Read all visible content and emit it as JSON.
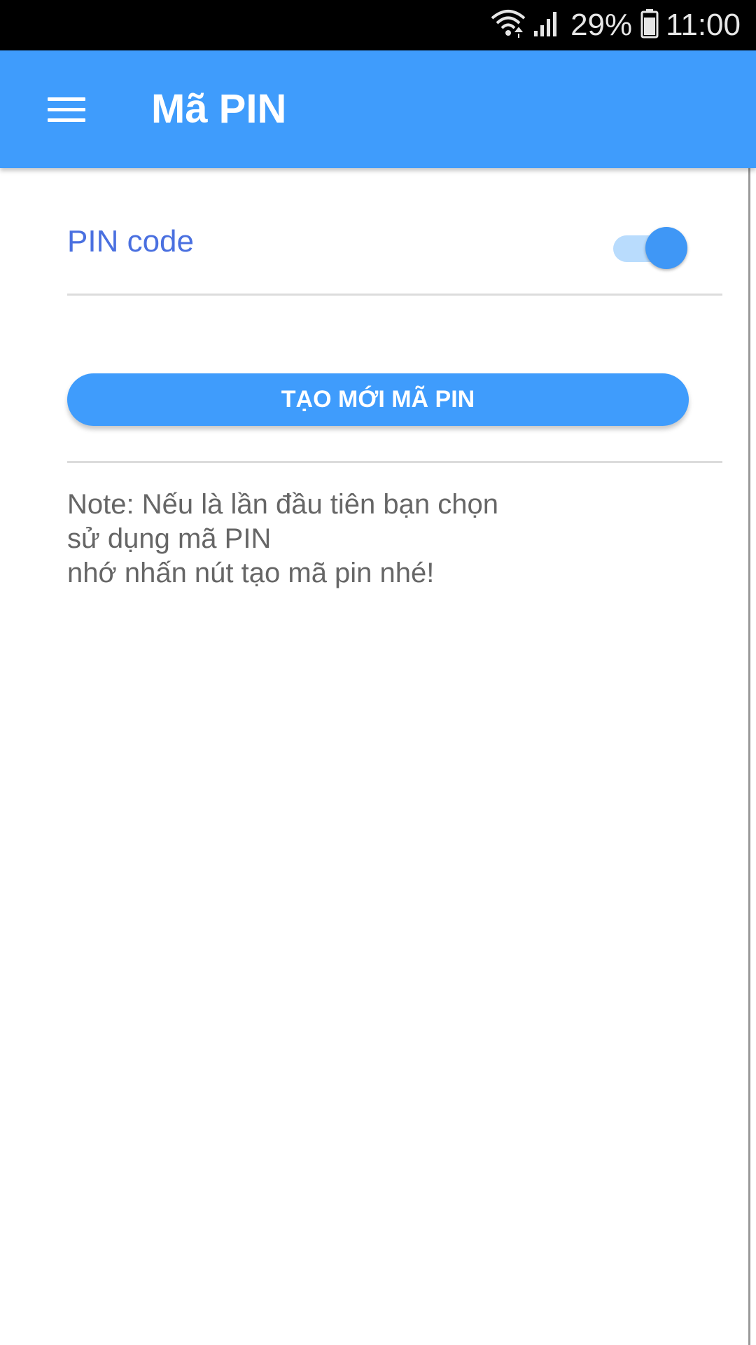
{
  "status_bar": {
    "battery_percent": "29%",
    "time": "11:00",
    "icons": [
      "wifi-icon",
      "signal-icon",
      "battery-icon"
    ]
  },
  "app_bar": {
    "title": "Mã PIN",
    "menu_icon": "hamburger-menu-icon",
    "color": "#3f9cfc"
  },
  "settings": {
    "pin_code": {
      "label": "PIN code",
      "enabled": true
    }
  },
  "actions": {
    "create_pin_label": "TẠO MỚI MÃ PIN"
  },
  "note": {
    "lines": [
      "Note: Nếu là lần đầu tiên bạn chọn",
      "sử dụng mã PIN",
      "nhớ nhấn nút tạo mã pin nhé!"
    ]
  },
  "colors": {
    "accent": "#3f9cfc",
    "label": "#4a70e0",
    "note_text": "#666666"
  }
}
